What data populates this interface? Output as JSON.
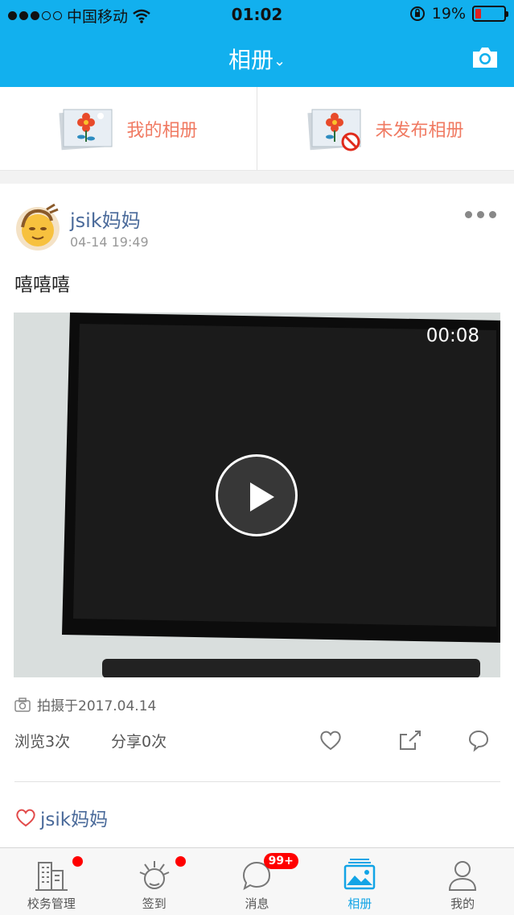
{
  "status_bar": {
    "carrier": "中国移动",
    "time": "01:02",
    "battery": "19%"
  },
  "navbar": {
    "title": "相册",
    "title_chevron": "⌄"
  },
  "albums": [
    {
      "label": "我的相册"
    },
    {
      "label": "未发布相册"
    }
  ],
  "post": {
    "username": "jsik妈妈",
    "time": "04-14 19:49",
    "caption": "嘻嘻嘻",
    "video": {
      "duration": "00:08"
    },
    "taken_on": "拍摄于2017.04.14",
    "views": "浏览3次",
    "shares": "分享0次",
    "liked_by": "jsik妈妈"
  },
  "tabbar": {
    "items": [
      {
        "label": "校务管理"
      },
      {
        "label": "签到"
      },
      {
        "label": "消息",
        "badge": "99+"
      },
      {
        "label": "相册"
      },
      {
        "label": "我的"
      }
    ]
  },
  "colors": {
    "primary": "#12b0ee",
    "accent_text": "#f07a62",
    "name_blue": "#4a6a9a",
    "alert_red": "#ff0000"
  }
}
